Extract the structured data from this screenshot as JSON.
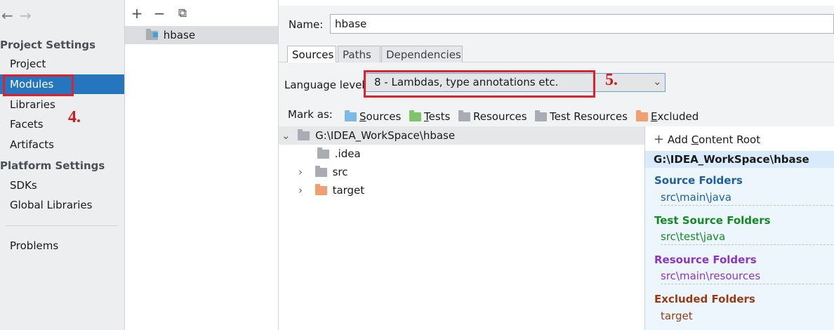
{
  "nav": {
    "back": "←",
    "forward": "→",
    "project_settings": "Project Settings",
    "project_items": [
      "Project",
      "Modules",
      "Libraries",
      "Facets",
      "Artifacts"
    ],
    "platform_settings": "Platform Settings",
    "platform_items": [
      "SDKs",
      "Global Libraries"
    ],
    "problems": "Problems",
    "selected": "Modules"
  },
  "annotations": {
    "step4": "4.",
    "step5": "5."
  },
  "modules_toolbar": {
    "add": "+",
    "remove": "−",
    "copy": "⧉"
  },
  "modules": [
    "hbase"
  ],
  "name_label": "Name:",
  "name_value": "hbase",
  "tabs": [
    "Sources",
    "Paths",
    "Dependencies"
  ],
  "active_tab": "Sources",
  "language_level": {
    "label": "Language level:",
    "value": "8 - Lambdas, type annotations etc."
  },
  "mark_as": {
    "label": "Mark as:",
    "sources_pre": "",
    "sources_u": "S",
    "sources_post": "ources",
    "tests_pre": "",
    "tests_u": "T",
    "tests_post": "ests",
    "resources": "Resources",
    "test_resources": "Test Resources",
    "excluded_pre": "",
    "excluded_u": "E",
    "excluded_post": "xcluded"
  },
  "tree": {
    "root": "G:\\IDEA_WorkSpace\\hbase",
    "children": [
      ".idea",
      "src",
      "target"
    ]
  },
  "roots": {
    "add_pre": "Add ",
    "add_u": "C",
    "add_post": "ontent Root",
    "header": "G:\\IDEA_WorkSpace\\hbase",
    "source_title": "Source Folders",
    "source_path": "src\\main\\java",
    "test_title": "Test Source Folders",
    "test_path": "src\\test\\java",
    "resource_title": "Resource Folders",
    "resource_path": "src\\main\\resources",
    "excluded_title": "Excluded Folders",
    "excluded_path": "target"
  },
  "colors": {
    "selected_nav": "#2675bf",
    "annotation_red": "#e0212b",
    "source": "#1c5fa8",
    "test": "#148a24",
    "resource": "#8a35c9",
    "excluded": "#9a3a12"
  }
}
